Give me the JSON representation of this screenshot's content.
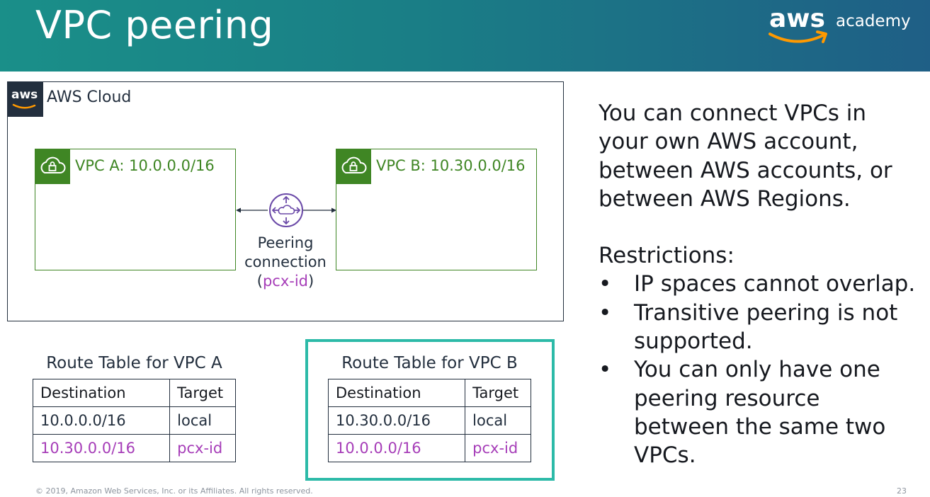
{
  "header": {
    "title": "VPC peering",
    "logo_aws": "aws",
    "logo_academy": "academy"
  },
  "diagram": {
    "cloud_badge": "aws",
    "cloud_label": "AWS Cloud",
    "vpc_a_label": "VPC A: 10.0.0.0/16",
    "vpc_b_label": "VPC B: 10.30.0.0/16",
    "peering_line1": "Peering",
    "peering_line2": "connection",
    "peering_open": "(",
    "peering_id": "pcx-id",
    "peering_close": ")"
  },
  "route_tables": [
    {
      "caption": "Route Table for VPC A",
      "headers": [
        "Destination",
        "Target"
      ],
      "rows": [
        [
          "10.0.0.0/16",
          "local"
        ],
        [
          "10.30.0.0/16",
          "pcx-id"
        ]
      ]
    },
    {
      "caption": "Route Table for VPC B",
      "headers": [
        "Destination",
        "Target"
      ],
      "rows": [
        [
          "10.30.0.0/16",
          "local"
        ],
        [
          "10.0.0.0/16",
          "pcx-id"
        ]
      ]
    }
  ],
  "description": {
    "intro": "You can connect VPCs in your own AWS account, between AWS accounts, or between AWS Regions.",
    "restrictions_heading": "Restrictions:",
    "bullet_glyph": "•",
    "bullets": [
      "IP spaces cannot overlap.",
      "Transitive peering is not supported.",
      "You can only have one peering resource between the same two VPCs."
    ]
  },
  "footer": {
    "copyright": "© 2019, Amazon Web Services, Inc. or its Affiliates. All rights reserved.",
    "page_number": "23"
  },
  "colors": {
    "header_start": "#1a8f89",
    "header_end": "#1f5f86",
    "vpc_green": "#3f8624",
    "peering_purple": "#8c4fff",
    "pcx_text": "#a63db8",
    "highlight_teal": "#2cbaa8",
    "aws_orange": "#ff9900"
  },
  "icons": {
    "cloud_badge_icon": "aws-logo-icon",
    "vpc_icon": "cloud-lock-icon",
    "peering_icon": "peering-connection-icon"
  }
}
